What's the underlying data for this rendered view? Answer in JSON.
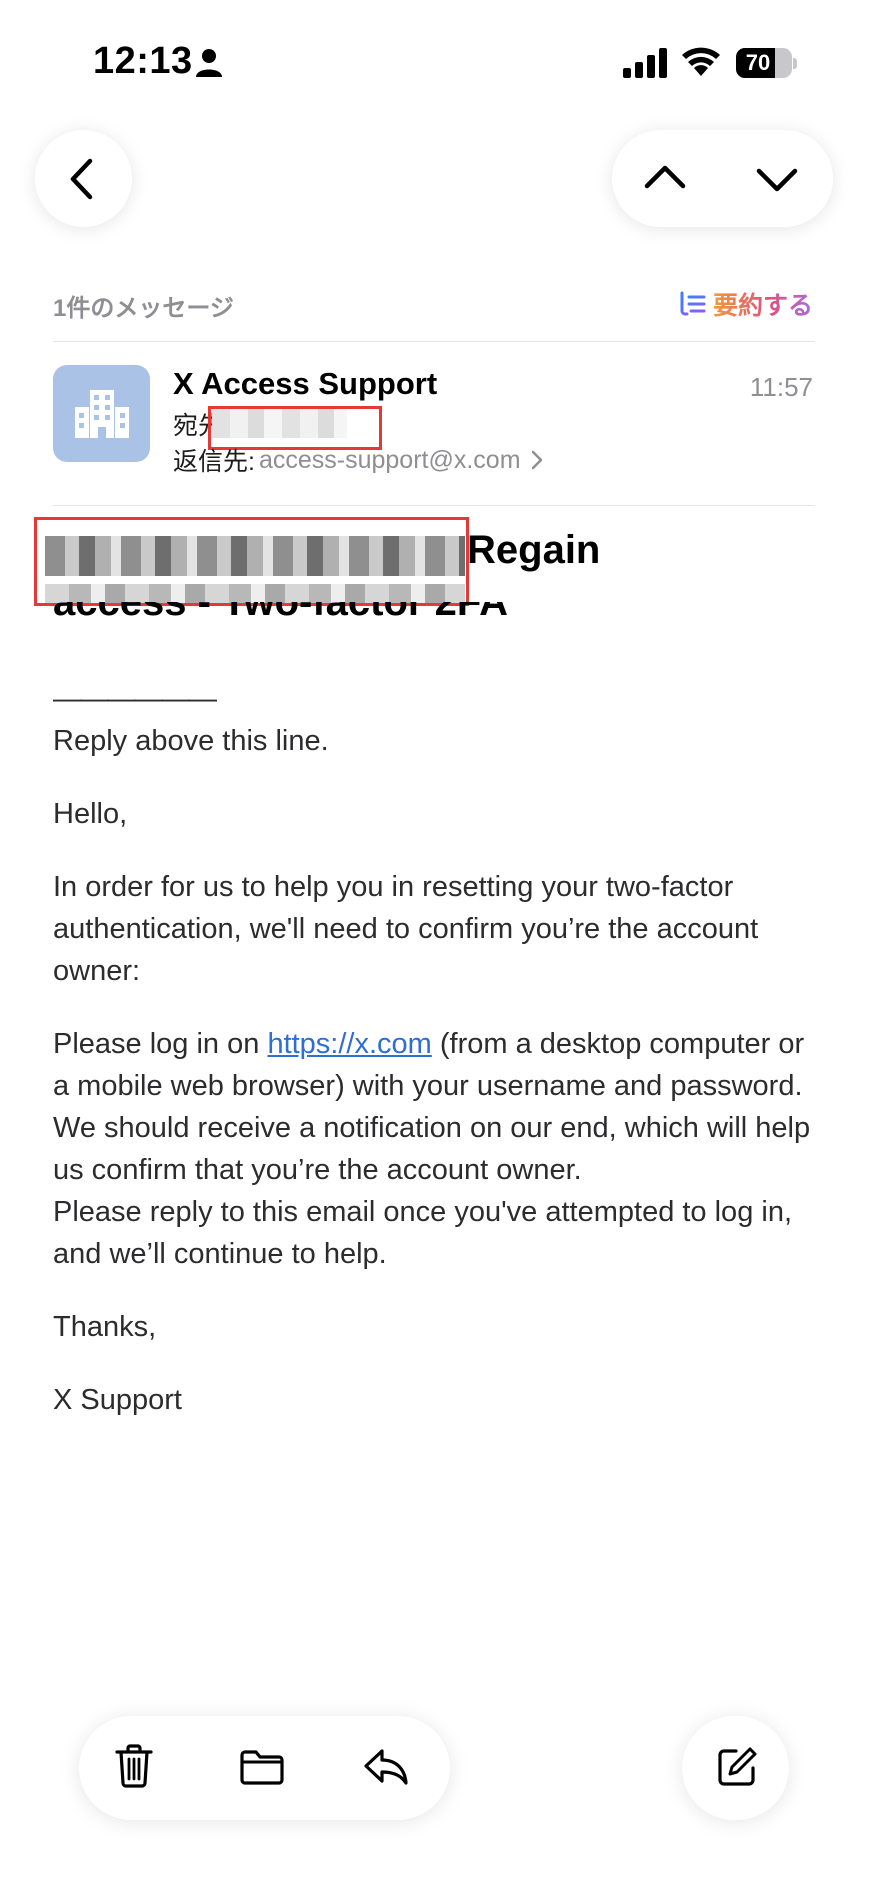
{
  "status_bar": {
    "time": "12:13",
    "battery_percent": "70",
    "battery_level": 0.7,
    "icons": [
      "person-icon",
      "cellular-signal-icon",
      "wifi-icon",
      "battery-icon"
    ]
  },
  "nav": {
    "back_icon": "chevron-left-icon",
    "prev_icon": "chevron-up-icon",
    "next_icon": "chevron-down-icon"
  },
  "thread": {
    "message_count": "1件のメッセージ",
    "summarize_label": "要約する",
    "summarize_icon": "summarize-icon"
  },
  "message": {
    "sender_name": "X Access Support",
    "time": "11:57",
    "to_label": "宛先",
    "reply_to_label": "返信先:",
    "reply_to_address": "access-support@x.com",
    "avatar_icon": "building-icon"
  },
  "subject": {
    "line1_visible": "Regain",
    "line2_visible": "access - Two-factor 2FA"
  },
  "body": {
    "separator": "——————",
    "reply_above": "Reply above this line.",
    "greeting": "Hello,",
    "para1": "In order for us to help you in resetting your two-factor authentication, we'll need to confirm you’re the account owner:",
    "para2_prefix": "Please log in on ",
    "para2_link": "https://x.com",
    "para2_suffix": " (from a desktop computer or a mobile web browser) with your username and password.",
    "para2_line2": "We should receive a notification on our end, which will help us confirm that you’re the account owner.",
    "para2_line3": "Please reply to this email once you've attempted to log in, and we’ll continue to help.",
    "thanks": "Thanks,",
    "signature": "X Support"
  },
  "toolbar": {
    "icons": [
      "trash-icon",
      "folder-icon",
      "reply-icon",
      "compose-icon"
    ]
  },
  "colors": {
    "link": "#2f6fd1",
    "avatar_bg": "#aac2e6",
    "redaction_box": "#e53935",
    "secondary_text": "#8e8e93"
  }
}
